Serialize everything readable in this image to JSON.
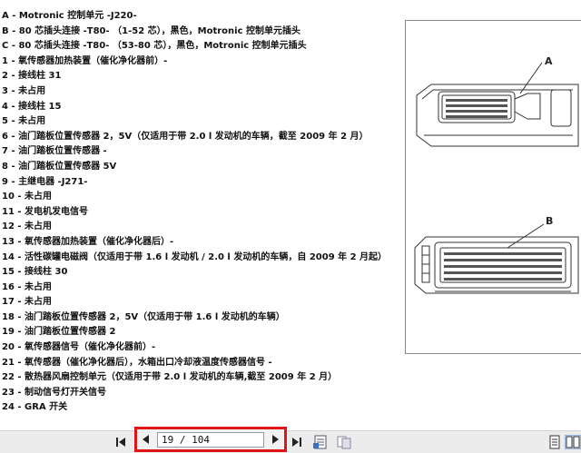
{
  "document": {
    "lines": [
      "A - Motronic 控制单元 -J220-",
      "B - 80 芯插头连接 -T80- （1-52 芯），黑色，Motronic 控制单元插头",
      "C - 80 芯插头连接 -T80- （53-80 芯），黑色，Motronic 控制单元插头",
      "1 - 氧传感器加热装置（催化净化器前）-",
      "2 - 接线柱 31",
      "3 - 未占用",
      "4 - 接线柱 15",
      "5 - 未占用",
      "6 - 油门踏板位置传感器 2，5V（仅适用于带 2.0 l 发动机的车辆，截至 2009 年 2 月）",
      "7 - 油门踏板位置传感器 -",
      "8 - 油门踏板位置传感器 5V",
      "9 - 主继电器 -J271-",
      "10 - 未占用",
      "11 - 发电机发电信号",
      "12 - 未占用",
      "13 - 氧传感器加热装置（催化净化器后）-",
      "14 - 活性碳罐电磁阀（仅适用于带 1.6 l 发动机 / 2.0 l 发动机的车辆，自 2009 年 2 月起）",
      "15 - 接线柱 30",
      "16 - 未占用",
      "17 - 未占用",
      "18 - 油门踏板位置传感器 2，5V（仅适用于带 1.6 l 发动机的车辆）",
      "19 - 油门踏板位置传感器 2",
      "20 - 氧传感器信号（催化净化器前）-",
      "21 - 氧传感器（催化净化器后），水箱出口冷却液温度传感器信号 -",
      "22 - 散热器风扇控制单元（仅适用于带 2.0 l 发动机的车辆,截至 2009 年 2 月）",
      "23 - 制动信号灯开关信号",
      "24 - GRA 开关"
    ]
  },
  "figure": {
    "label_a": "A",
    "label_b": "B"
  },
  "toolbar": {
    "page_value": "19 / 104",
    "icons": [
      "first-page-icon",
      "prev-page-icon",
      "next-page-icon",
      "last-page-icon",
      "page-view-icon",
      "page-layout-icon",
      "single-page-icon",
      "two-page-icon"
    ]
  }
}
